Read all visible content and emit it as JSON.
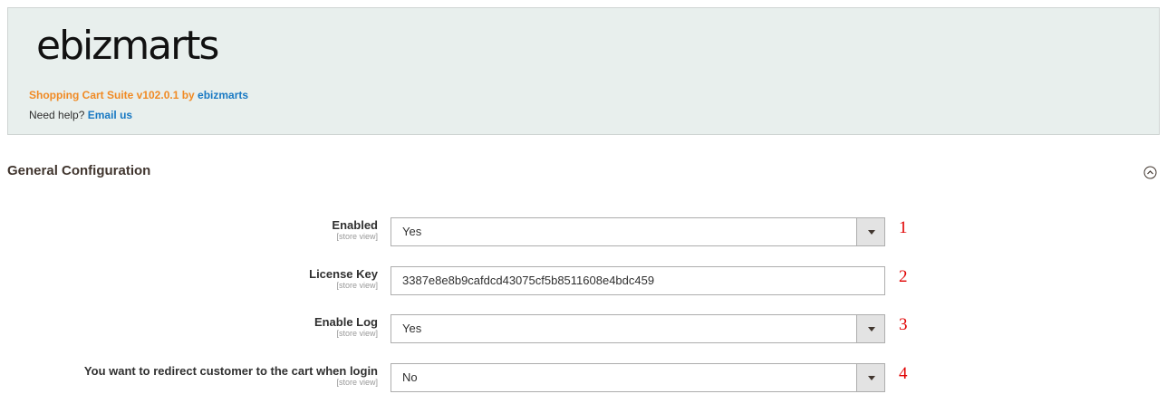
{
  "header": {
    "logo_text": "ebizmarts",
    "suite_prefix": "Shopping Cart Suite v102.0.1 by ",
    "suite_vendor": "ebizmarts",
    "help_prefix": "Need help? ",
    "help_link": "Email us"
  },
  "section": {
    "title": "General Configuration",
    "collapse_icon": "chevron-up-circle-icon"
  },
  "fields": [
    {
      "label": "Enabled",
      "scope": "[store view]",
      "type": "select",
      "value": "Yes",
      "annotation": "1"
    },
    {
      "label": "License Key",
      "scope": "[store view]",
      "type": "text",
      "value": "3387e8e8b9cafdcd43075cf5b8511608e4bdc459",
      "annotation": "2"
    },
    {
      "label": "Enable Log",
      "scope": "[store view]",
      "type": "select",
      "value": "Yes",
      "annotation": "3"
    },
    {
      "label": "You want to redirect customer to the cart when login",
      "scope": "[store view]",
      "type": "select",
      "value": "No",
      "annotation": "4"
    }
  ],
  "colors": {
    "header_bg": "#e8efed",
    "orange": "#f08a24",
    "link_blue": "#1979c3",
    "annotation_red": "#e00000"
  }
}
